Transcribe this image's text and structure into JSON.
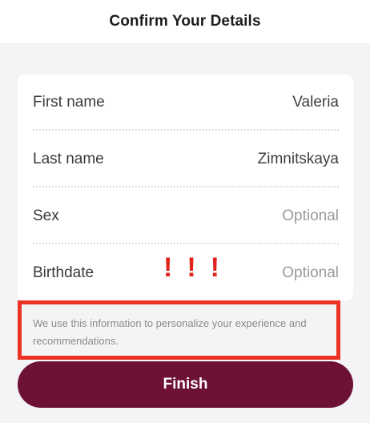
{
  "header": {
    "title": "Confirm Your Details"
  },
  "form": {
    "rows": [
      {
        "label": "First name",
        "value": "Valeria"
      },
      {
        "label": "Last name",
        "value": "Zimnitskaya"
      },
      {
        "label": "Sex",
        "placeholder": "Optional"
      },
      {
        "label": "Birthdate",
        "placeholder": "Optional"
      }
    ]
  },
  "annotation": {
    "marks": [
      "!",
      "!",
      "!"
    ],
    "highlight_color": "#ea3323"
  },
  "info": {
    "text": "We use this information to personalize your experience and recommendations."
  },
  "actions": {
    "finish_label": "Finish"
  },
  "colors": {
    "accent": "#6d1236",
    "background": "#f4f4f6"
  }
}
